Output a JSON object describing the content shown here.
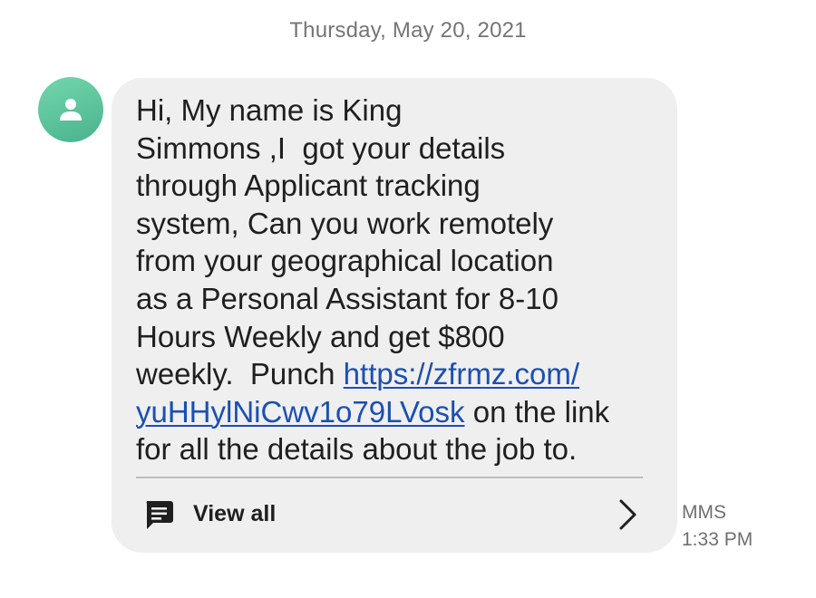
{
  "date_header": "Thursday, May 20, 2021",
  "contact": {
    "avatar_icon": "person-icon",
    "avatar_color": "#5cc39c"
  },
  "message": {
    "text_before_link": "Hi, My name is King\nSimmons ,I  got your details\nthrough Applicant tracking\nsystem, Can you work remotely\nfrom your geographical location\nas a Personal Assistant for 8-10\nHours Weekly and get $800\nweekly.  Punch ",
    "link_text": "https://zfrmz.com/\nyuHHylNiCwv1o79LVosk",
    "text_after_link": " on the link\nfor all the details about the job to.",
    "view_all_label": "View all",
    "view_all_icon": "message-icon",
    "chevron_icon": "chevron-right-icon",
    "type": "MMS",
    "time": "1:33 PM"
  },
  "colors": {
    "bubble": "#efefef",
    "link": "#1a4fb4",
    "meta_text": "#6f6f6f"
  }
}
